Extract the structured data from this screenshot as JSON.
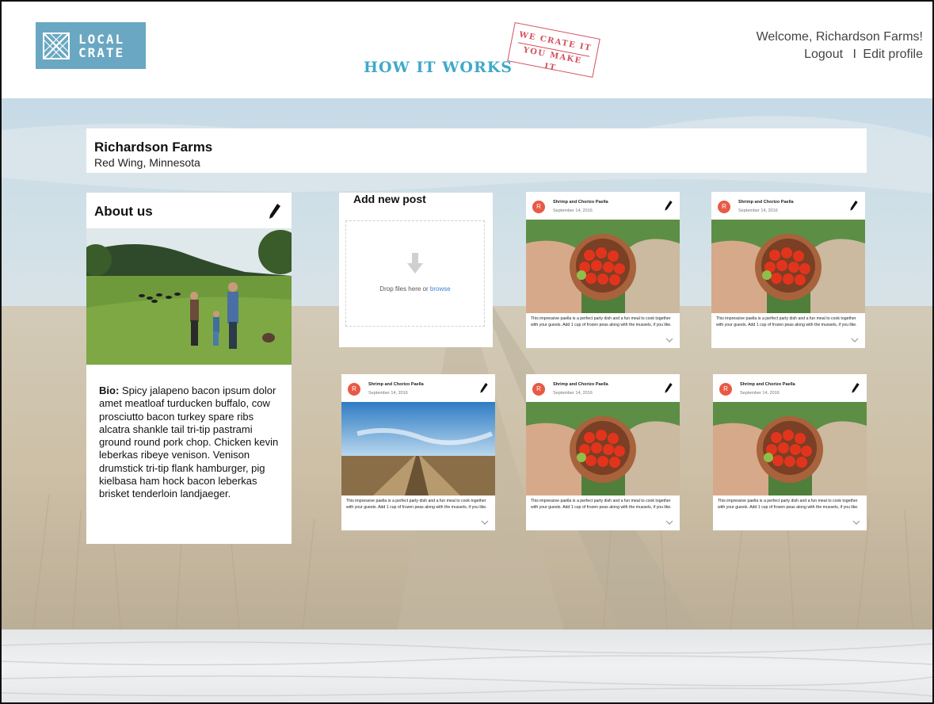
{
  "header": {
    "logo_line1": "LOCAL",
    "logo_line2": "CRATE",
    "nav_how_it_works": "HOW IT WORKS",
    "stamp_line1": "WE CRATE IT",
    "stamp_line2": "YOU MAKE IT",
    "welcome": "Welcome, Richardson Farms!",
    "logout": "Logout",
    "separator": "I",
    "edit_profile": "Edit profile"
  },
  "farm": {
    "name": "Richardson Farms",
    "location": "Red Wing, Minnesota"
  },
  "about": {
    "title": "About us",
    "bio_label": "Bio:",
    "bio_text": " Spicy jalapeno bacon ipsum dolor amet meatloaf turducken buffalo, cow prosciutto bacon turkey spare ribs alcatra shankle tail tri-tip pastrami ground round pork chop. Chicken kevin leberkas ribeye venison. Venison drumstick tri-tip flank hamburger, pig kielbasa ham hock bacon leberkas brisket tenderloin landjaeger."
  },
  "add_post": {
    "title": "Add new post",
    "drop_text": "Drop files here or ",
    "browse": "browse"
  },
  "posts": [
    {
      "avatar": "R",
      "title": "Shrimp and Chorizo Paella",
      "date": "September 14, 2016",
      "image": "tomatoes",
      "text": "This impressive paella is a perfect party dish and a fun meal to cook together with your guests. Add 1 cup of frozen peas along with the mussels, if you like."
    },
    {
      "avatar": "R",
      "title": "Shrimp and Chorizo Paella",
      "date": "September 14, 2016",
      "image": "tomatoes",
      "text": "This impressive paella is a perfect party dish and a fun meal to cook together with your guests. Add 1 cup of frozen peas along with the mussels, if you like."
    },
    {
      "avatar": "R",
      "title": "Shrimp and Chorizo Paella",
      "date": "September 14, 2016",
      "image": "field",
      "text": "This impressive paella is a perfect party dish and a fun meal to cook together with your guests. Add 1 cup of frozen peas along with the mussels, if you like."
    },
    {
      "avatar": "R",
      "title": "Shrimp and Chorizo Paella",
      "date": "September 14, 2016",
      "image": "tomatoes",
      "text": "This impressive paella is a perfect party dish and a fun meal to cook together with your guests. Add 1 cup of frozen peas along with the mussels, if you like."
    },
    {
      "avatar": "R",
      "title": "Shrimp and Chorizo Paella",
      "date": "September 14, 2016",
      "image": "tomatoes",
      "text": "This impressive paella is a perfect party dish and a fun meal to cook together with your guests. Add 1 cup of frozen peas along with the mussels, if you like."
    }
  ],
  "icons": {
    "edit": "pencil-icon",
    "expand": "chevron-down-icon",
    "upload": "arrow-down-icon"
  },
  "colors": {
    "brand": "#6aa7c2",
    "nav": "#3fa9c9",
    "stamp": "#d44f5c",
    "avatar": "#e85a45",
    "link": "#3d82d8"
  }
}
